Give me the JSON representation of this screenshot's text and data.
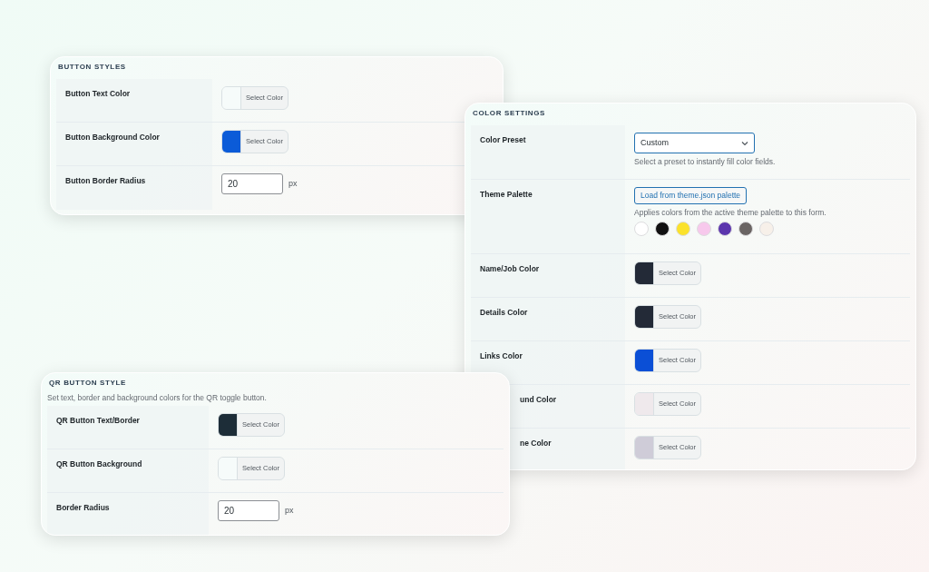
{
  "panels": [
    {
      "title": "BUTTON STYLES",
      "rows": [
        {
          "kind": "color",
          "label": "Button Text Color",
          "color": "#f6fbfa",
          "button": "Select Color"
        },
        {
          "kind": "color",
          "label": "Button Background Color",
          "color": "#0b5bd8",
          "button": "Select Color"
        },
        {
          "kind": "number",
          "label": "Button Border Radius",
          "value": "20",
          "unit": "px"
        }
      ]
    },
    {
      "title": "COLOR SETTINGS",
      "rows": [
        {
          "kind": "select",
          "label": "Color Preset",
          "value": "Custom",
          "help": "Select a preset to instantly fill color fields."
        },
        {
          "kind": "palette",
          "label": "Theme Palette",
          "button": "Load from theme.json palette",
          "help": "Applies colors from the active theme palette to this form.",
          "colors": [
            {
              "color": "#ffffff"
            },
            {
              "color": "#111111"
            },
            {
              "color": "#fbe22b"
            },
            {
              "color": "#f7c8ec"
            },
            {
              "color": "#5b35ad"
            },
            {
              "color": "#6a6463"
            },
            {
              "color": "#f7f0e9"
            }
          ]
        },
        {
          "kind": "color",
          "label": "Name/Job Color",
          "color": "#232a37",
          "button": "Select Color"
        },
        {
          "kind": "color",
          "label": "Details Color",
          "color": "#232a37",
          "button": "Select Color"
        },
        {
          "kind": "color",
          "label": "Links Color",
          "color": "#0b4fd6",
          "button": "Select Color"
        },
        {
          "kind": "color_cut",
          "label": "und Color",
          "color": "#efe9ec",
          "button": "Select Color"
        },
        {
          "kind": "color_cut",
          "label": "ne Color",
          "color": "#cfccd8",
          "button": "Select Color"
        }
      ]
    },
    {
      "title": "QR BUTTON STYLE",
      "description": "Set text, border and background colors for the QR toggle button.",
      "rows": [
        {
          "kind": "color",
          "label": "QR Button Text/Border",
          "color": "#1d2d38",
          "button": "Select Color"
        },
        {
          "kind": "color",
          "label": "QR Button Background",
          "color": "#f6fbfa",
          "button": "Select Color"
        },
        {
          "kind": "number",
          "label": "Border Radius",
          "value": "20",
          "unit": "px"
        }
      ]
    }
  ]
}
